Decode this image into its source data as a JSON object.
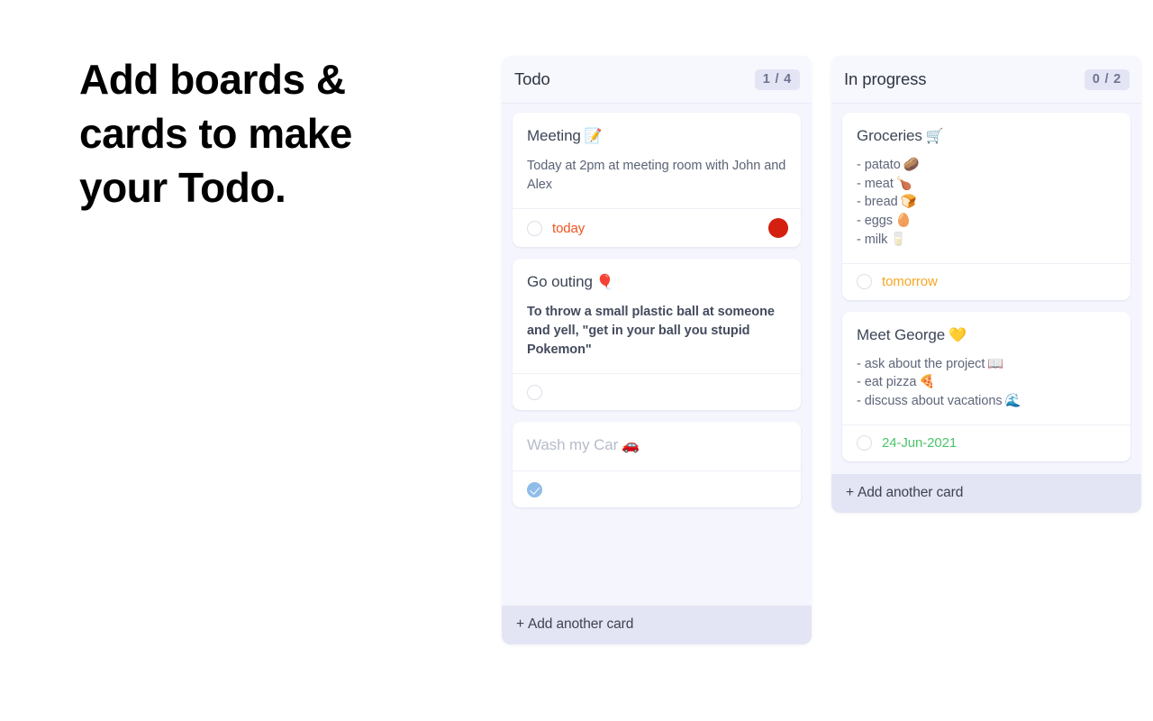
{
  "headline": {
    "line1_strong": "Add",
    "line1_rest": " boards &",
    "line2": "cards to make",
    "line3": "your Todo."
  },
  "colors": {
    "column_bg": "#f4f5fd",
    "column_header_bg": "#f7f8fe",
    "footer_bg": "#e3e4f4",
    "badge_bg": "#e3e4f4",
    "badge_text": "#6f7590",
    "card_bg": "#ffffff",
    "title_text": "#3d4657",
    "due_today": "#f0541e",
    "due_tomorrow": "#f5a623",
    "due_date": "#4cc46a",
    "flag_red": "#d32011",
    "check_blue": "#90bde8"
  },
  "board": {
    "columns": [
      {
        "id": "todo",
        "title": "Todo",
        "badge": "1 / 4",
        "add_card_label": "Add another card",
        "add_card_plus": "+",
        "cards": [
          {
            "id": "meeting",
            "title": "Meeting",
            "emoji": "📝",
            "emoji_name": "memo-icon",
            "desc": "Today at 2pm at meeting room with John and Alex",
            "desc_bold": false,
            "checked": false,
            "due": "today",
            "due_kind": "due-today",
            "flag": true,
            "done": false
          },
          {
            "id": "go-outing",
            "title": "Go outing",
            "emoji": "🎈",
            "emoji_name": "balloon-icon",
            "desc": "To throw a small plastic ball at someone and yell, \"get in your ball you stupid Pokemon\"",
            "desc_bold": true,
            "checked": false,
            "due": "",
            "due_kind": "",
            "flag": false,
            "done": false
          },
          {
            "id": "wash-my-car",
            "title": "Wash my Car",
            "emoji": "🚗",
            "emoji_name": "car-icon",
            "desc": "",
            "desc_bold": false,
            "checked": true,
            "due": "",
            "due_kind": "",
            "flag": false,
            "done": true
          }
        ]
      },
      {
        "id": "in-progress",
        "title": "In progress",
        "badge": "0 / 2",
        "add_card_label": "Add another card",
        "add_card_plus": "+",
        "cards": [
          {
            "id": "groceries",
            "title": "Groceries",
            "emoji": "🛒",
            "emoji_name": "shopping-cart-icon",
            "list": [
              {
                "text": "- patato",
                "emoji": "🥔",
                "emoji_name": "potato-icon"
              },
              {
                "text": "- meat",
                "emoji": "🍗",
                "emoji_name": "poultry-leg-icon"
              },
              {
                "text": "- bread",
                "emoji": "🍞",
                "emoji_name": "bread-icon"
              },
              {
                "text": "- eggs",
                "emoji": "🥚",
                "emoji_name": "egg-icon"
              },
              {
                "text": "- milk",
                "emoji": "🥛",
                "emoji_name": "milk-glass-icon"
              }
            ],
            "checked": false,
            "due": "tomorrow",
            "due_kind": "due-tomorrow",
            "flag": false,
            "done": false
          },
          {
            "id": "meet-george",
            "title": "Meet George",
            "emoji": "💛",
            "emoji_name": "yellow-heart-icon",
            "list": [
              {
                "text": "- ask about the project",
                "emoji": "📖",
                "emoji_name": "book-icon"
              },
              {
                "text": "- eat pizza",
                "emoji": "🍕",
                "emoji_name": "pizza-icon"
              },
              {
                "text": "- discuss about vacations",
                "emoji": "🌊",
                "emoji_name": "wave-icon"
              }
            ],
            "checked": false,
            "due": "24-Jun-2021",
            "due_kind": "due-date",
            "flag": false,
            "done": false
          }
        ]
      }
    ]
  }
}
